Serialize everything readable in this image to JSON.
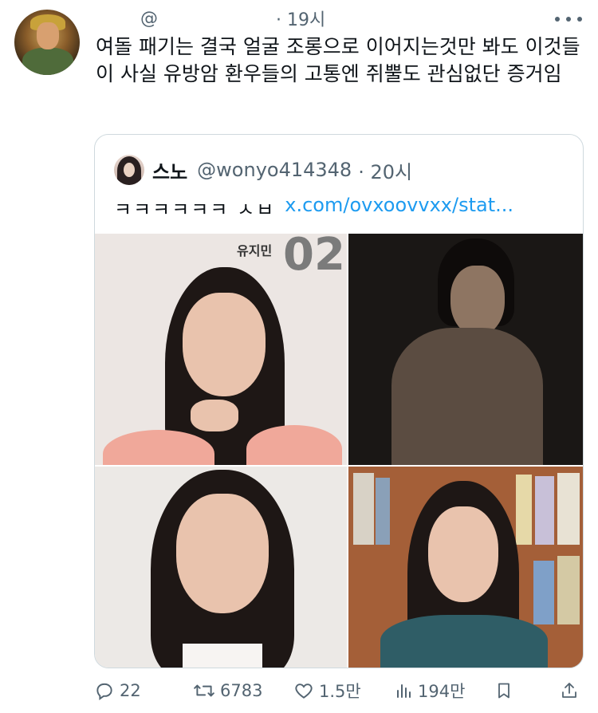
{
  "tweet": {
    "handle_prefix": "@",
    "time": "· 19시",
    "text": "여돌 패기는 결국 얼굴 조롱으로 이어지는것만 봐도 이것들이 사실 유방암 환우들의 고통엔 쥐뿔도 관심없단 증거임"
  },
  "quote": {
    "name": "스노",
    "handle": "@wonyo414348",
    "time": "· 20시",
    "text": "ㅋㅋㅋㅋㅋㅋ ㅅㅂ",
    "link": "x.com/ovxoovvxx/stat...",
    "image_label": "유지민",
    "image_number": "02"
  },
  "actions": {
    "replies": "22",
    "retweets": "6783",
    "likes": "1.5만",
    "views": "194만"
  },
  "icons": {
    "more": "more-dots-icon",
    "reply": "reply-icon",
    "retweet": "retweet-icon",
    "like": "heart-icon",
    "views": "views-chart-icon",
    "bookmark": "bookmark-icon",
    "share": "share-icon"
  },
  "colors": {
    "link": "#1d9bf0",
    "secondary_text": "#536471",
    "border": "#cfd9de"
  }
}
